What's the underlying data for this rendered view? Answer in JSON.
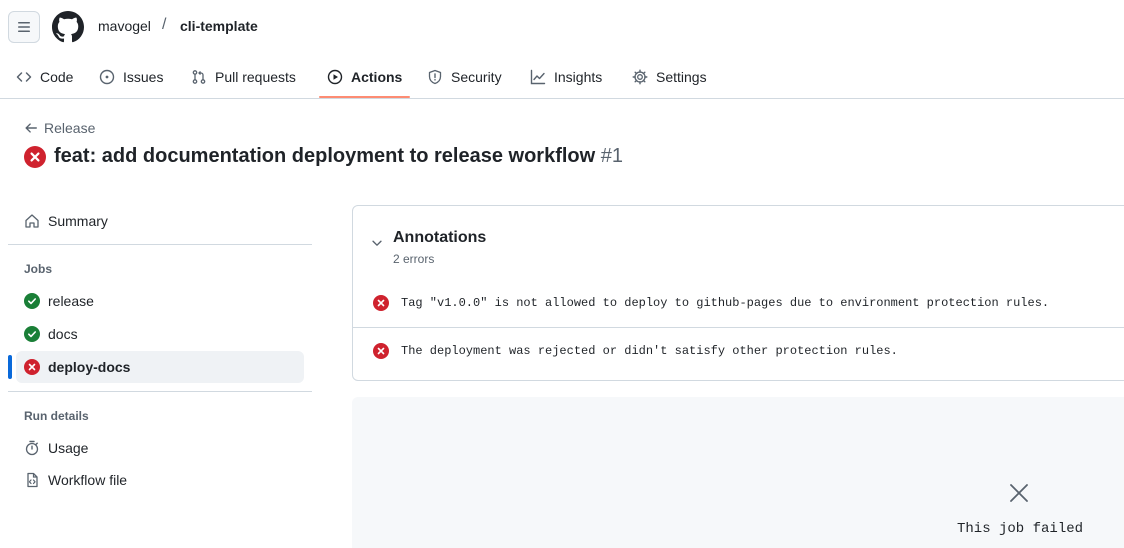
{
  "header": {
    "owner": "mavogel",
    "separator": "/",
    "repo": "cli-template"
  },
  "tabs": [
    {
      "label": "Code",
      "icon": "code-icon",
      "active": false
    },
    {
      "label": "Issues",
      "icon": "issue-opened-icon",
      "active": false
    },
    {
      "label": "Pull requests",
      "icon": "git-pull-request-icon",
      "active": false
    },
    {
      "label": "Actions",
      "icon": "play-icon",
      "active": true
    },
    {
      "label": "Security",
      "icon": "shield-icon",
      "active": false
    },
    {
      "label": "Insights",
      "icon": "graph-icon",
      "active": false
    },
    {
      "label": "Settings",
      "icon": "gear-icon",
      "active": false
    }
  ],
  "run": {
    "back_label": "Release",
    "title": "feat: add documentation deployment to release workflow",
    "number": "#1",
    "status": "failure"
  },
  "sidebar": {
    "summary_label": "Summary",
    "jobs_heading": "Jobs",
    "jobs": [
      {
        "label": "release",
        "status": "success"
      },
      {
        "label": "docs",
        "status": "success"
      },
      {
        "label": "deploy-docs",
        "status": "failure",
        "selected": true
      }
    ],
    "run_details_heading": "Run details",
    "run_details": [
      {
        "label": "Usage",
        "icon": "stopwatch-icon"
      },
      {
        "label": "Workflow file",
        "icon": "file-code-icon"
      }
    ]
  },
  "annotations": {
    "title": "Annotations",
    "count": "2 errors",
    "items": [
      {
        "level": "error",
        "message": "Tag \"v1.0.0\" is not allowed to deploy to github-pages due to environment protection rules."
      },
      {
        "level": "error",
        "message": "The deployment was rejected or didn't satisfy other protection rules."
      }
    ]
  },
  "job_log": {
    "status_text": "This job failed"
  },
  "colors": {
    "accent_underline": "#fd8c73",
    "success": "#1a7f37",
    "failure": "#cf222e",
    "selected_indicator": "#0969da"
  }
}
